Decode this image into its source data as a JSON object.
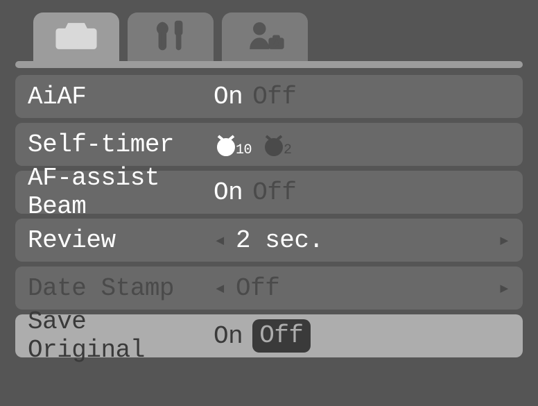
{
  "tabs": [
    {
      "id": "shooting",
      "icon": "camera",
      "active": true
    },
    {
      "id": "setup",
      "icon": "tools",
      "active": false
    },
    {
      "id": "mycamera",
      "icon": "person-camera",
      "active": false
    }
  ],
  "menu": {
    "aiaf": {
      "label": "AiAF",
      "selected": "On",
      "alt": "Off"
    },
    "self_timer": {
      "label": "Self-timer",
      "selected_sub": "10",
      "alt_sub": "2"
    },
    "af_assist": {
      "label": "AF-assist Beam",
      "selected": "On",
      "alt": "Off"
    },
    "review": {
      "label": "Review",
      "value": "2 sec."
    },
    "date_stamp": {
      "label": "Date Stamp",
      "value": "Off",
      "disabled": true
    },
    "save_original": {
      "label": "Save Original",
      "alt": "On",
      "selected": "Off",
      "highlighted": true
    }
  }
}
